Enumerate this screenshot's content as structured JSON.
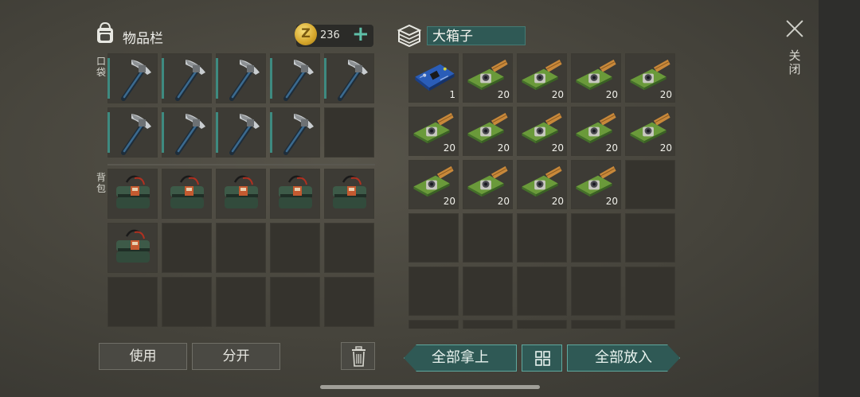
{
  "inventory": {
    "title": "物品栏",
    "coins": "236",
    "coin_symbol": "Z",
    "plus": "+",
    "pocket_label": "口袋",
    "backpack_label": "背包",
    "pocket_items": [
      "pickaxe",
      "pickaxe",
      "pickaxe",
      "pickaxe",
      "pickaxe",
      "pickaxe",
      "pickaxe",
      "pickaxe",
      "pickaxe",
      ""
    ],
    "backpack_items": [
      "backpack",
      "backpack",
      "backpack",
      "backpack",
      "backpack",
      "backpack",
      "",
      "",
      "",
      "",
      "",
      "",
      "",
      "",
      ""
    ]
  },
  "chest": {
    "name": "大箱子",
    "items": [
      {
        "icon": "circuit-board",
        "qty": "1"
      },
      {
        "icon": "camera-module",
        "qty": "20"
      },
      {
        "icon": "camera-module",
        "qty": "20"
      },
      {
        "icon": "camera-module",
        "qty": "20"
      },
      {
        "icon": "camera-module",
        "qty": "20"
      },
      {
        "icon": "camera-module",
        "qty": "20"
      },
      {
        "icon": "camera-module",
        "qty": "20"
      },
      {
        "icon": "camera-module",
        "qty": "20"
      },
      {
        "icon": "camera-module",
        "qty": "20"
      },
      {
        "icon": "camera-module",
        "qty": "20"
      },
      {
        "icon": "camera-module",
        "qty": "20"
      },
      {
        "icon": "camera-module",
        "qty": "20"
      },
      {
        "icon": "camera-module",
        "qty": "20"
      },
      {
        "icon": "camera-module",
        "qty": "20"
      }
    ]
  },
  "buttons": {
    "use": "使用",
    "split": "分开",
    "take_all": "全部拿上",
    "put_all": "全部放入",
    "close": "关闭"
  },
  "colors": {
    "accent": "#2f5955",
    "accent_border": "#5fa89e",
    "slot": "#35332d"
  }
}
